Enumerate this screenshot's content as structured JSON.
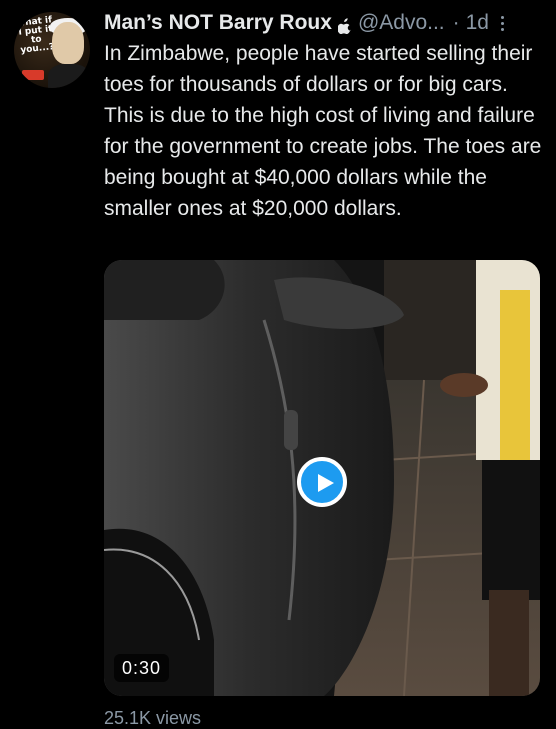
{
  "tweet": {
    "display_name": "Man’s NOT Barry Roux",
    "verified_icon": "apple-icon",
    "handle": "@Advo...",
    "separator": "·",
    "time": "1d",
    "text": "In Zimbabwe, people have started selling their toes for thousands of dollars or for big cars. This is due to the high cost of living and failure for the government to create jobs. The toes are being bought at $40,000 dollars while the smaller ones at $20,000 dollars.",
    "avatar": {
      "caption": "what if I put it to you...?",
      "icon": "avatar-cartoon"
    },
    "media": {
      "type": "video",
      "duration": "0:30",
      "play_icon": "play-icon"
    },
    "views": "25.1K views"
  },
  "colors": {
    "background": "#000000",
    "text_primary": "#e7e9ea",
    "text_secondary": "#8b98a5",
    "accent": "#1d9bf0"
  }
}
